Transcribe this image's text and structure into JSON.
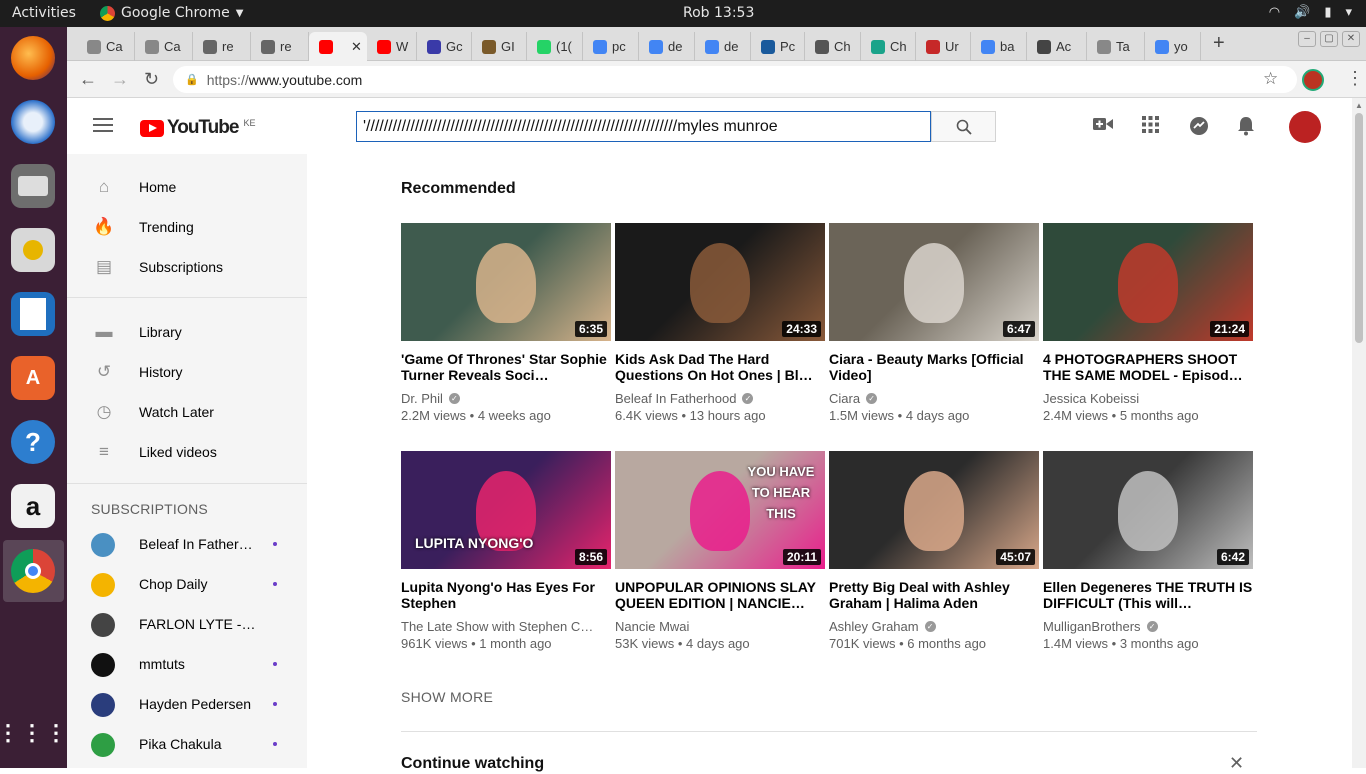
{
  "topbar": {
    "activities": "Activities",
    "app_name": "Google Chrome",
    "clock": "Rob 13:53"
  },
  "tabs": [
    {
      "label": "Ca",
      "icon": "doc-icon"
    },
    {
      "label": "Ca",
      "icon": "doc-icon"
    },
    {
      "label": "re",
      "icon": "circle-icon"
    },
    {
      "label": "re",
      "icon": "circle-icon"
    },
    {
      "label": "",
      "icon": "youtube-icon",
      "active": true
    },
    {
      "label": "W",
      "icon": "youtube-icon"
    },
    {
      "label": "Gc",
      "icon": "calendar-icon"
    },
    {
      "label": "GI",
      "icon": "gif-icon"
    },
    {
      "label": "(1(",
      "icon": "whatsapp-icon"
    },
    {
      "label": "pc",
      "icon": "google-icon"
    },
    {
      "label": "de",
      "icon": "google-icon"
    },
    {
      "label": "de",
      "icon": "google-icon"
    },
    {
      "label": "Pc",
      "icon": "webmd-icon"
    },
    {
      "label": "Ch",
      "icon": "wikipedia-icon"
    },
    {
      "label": "Ch",
      "icon": "green-icon"
    },
    {
      "label": "Ur",
      "icon": "red-icon"
    },
    {
      "label": "ba",
      "icon": "google-icon"
    },
    {
      "label": "Ac",
      "icon": "link-icon"
    },
    {
      "label": "Ta",
      "icon": "doc-icon"
    },
    {
      "label": "yo",
      "icon": "google-icon"
    }
  ],
  "url": {
    "protocol": "https://",
    "host": "www.youtube.com"
  },
  "youtube": {
    "logo_text": "YouTube",
    "country_code": "KE",
    "search_query": "'//////////////////////////////////////////////////////////////////////myles munroe"
  },
  "sidebar": {
    "main": [
      {
        "label": "Home",
        "icon": "home-icon"
      },
      {
        "label": "Trending",
        "icon": "flame-icon"
      },
      {
        "label": "Subscriptions",
        "icon": "subscriptions-icon"
      }
    ],
    "library": [
      {
        "label": "Library",
        "icon": "folder-icon"
      },
      {
        "label": "History",
        "icon": "history-icon"
      },
      {
        "label": "Watch Later",
        "icon": "clock-icon"
      },
      {
        "label": "Liked videos",
        "icon": "playlist-icon"
      }
    ],
    "subscriptions_title": "SUBSCRIPTIONS",
    "subscriptions": [
      {
        "label": "Beleaf In Fatherhood",
        "color": "#4a90c2",
        "new": true
      },
      {
        "label": "Chop Daily",
        "color": "#f4b400",
        "new": true
      },
      {
        "label": "FARLON LYTE - TV",
        "color": "#444444",
        "new": false
      },
      {
        "label": "mmtuts",
        "color": "#111111",
        "new": true
      },
      {
        "label": "Hayden Pedersen",
        "color": "#2a3d7c",
        "new": true
      },
      {
        "label": "Pika Chakula",
        "color": "#2e9e44",
        "new": true
      }
    ]
  },
  "main": {
    "section_title": "Recommended",
    "videos": [
      {
        "title": "'Game Of Thrones' Star Sophie Turner Reveals Soci…",
        "channel": "Dr. Phil",
        "verified": true,
        "views": "2.2M views",
        "age": "4 weeks ago",
        "duration": "6:35",
        "bg": "#3f5b4e",
        "accent": "#d8b48c"
      },
      {
        "title": "Kids Ask Dad The Hard Questions On Hot Ones | Bl…",
        "channel": "Beleaf In Fatherhood",
        "verified": true,
        "views": "6.4K views",
        "age": "13 hours ago",
        "duration": "24:33",
        "bg": "#1a1a1a",
        "accent": "#8a5a3a"
      },
      {
        "title": "Ciara - Beauty Marks [Official Video]",
        "channel": "Ciara",
        "verified": true,
        "views": "1.5M views",
        "age": "4 days ago",
        "duration": "6:47",
        "bg": "#6b6458",
        "accent": "#d9d4cc"
      },
      {
        "title": "4 PHOTOGRAPHERS SHOOT THE SAME MODEL - Episod…",
        "channel": "Jessica Kobeissi",
        "verified": false,
        "views": "2.4M views",
        "age": "5 months ago",
        "duration": "21:24",
        "bg": "#2f4a3a",
        "accent": "#c0392b"
      },
      {
        "title": "Lupita Nyong'o Has Eyes For Stephen",
        "channel": "The Late Show with Stephen C…",
        "verified": false,
        "views": "961K views",
        "age": "1 month ago",
        "duration": "8:56",
        "bg": "#3a1f5c",
        "accent": "#e8246c",
        "overlay": "LUPITA NYONG'O"
      },
      {
        "title": "UNPOPULAR OPINIONS SLAY QUEEN EDITION | NANCIE…",
        "channel": "Nancie Mwai",
        "verified": false,
        "views": "53K views",
        "age": "4 days ago",
        "duration": "20:11",
        "bg": "#b8a8a0",
        "accent": "#e91e8c",
        "overlay": "YOU HAVE TO HEAR THIS"
      },
      {
        "title": "Pretty Big Deal with Ashley Graham | Halima Aden",
        "channel": "Ashley Graham",
        "verified": true,
        "views": "701K views",
        "age": "6 months ago",
        "duration": "45:07",
        "bg": "#2b2b2b",
        "accent": "#d9a88a"
      },
      {
        "title": "Ellen Degeneres THE TRUTH IS DIFFICULT (This will…",
        "channel": "MulliganBrothers",
        "verified": true,
        "views": "1.4M views",
        "age": "3 months ago",
        "duration": "6:42",
        "bg": "#3a3a3a",
        "accent": "#bfbfbf"
      }
    ],
    "show_more": "SHOW MORE",
    "continue_title": "Continue watching"
  }
}
